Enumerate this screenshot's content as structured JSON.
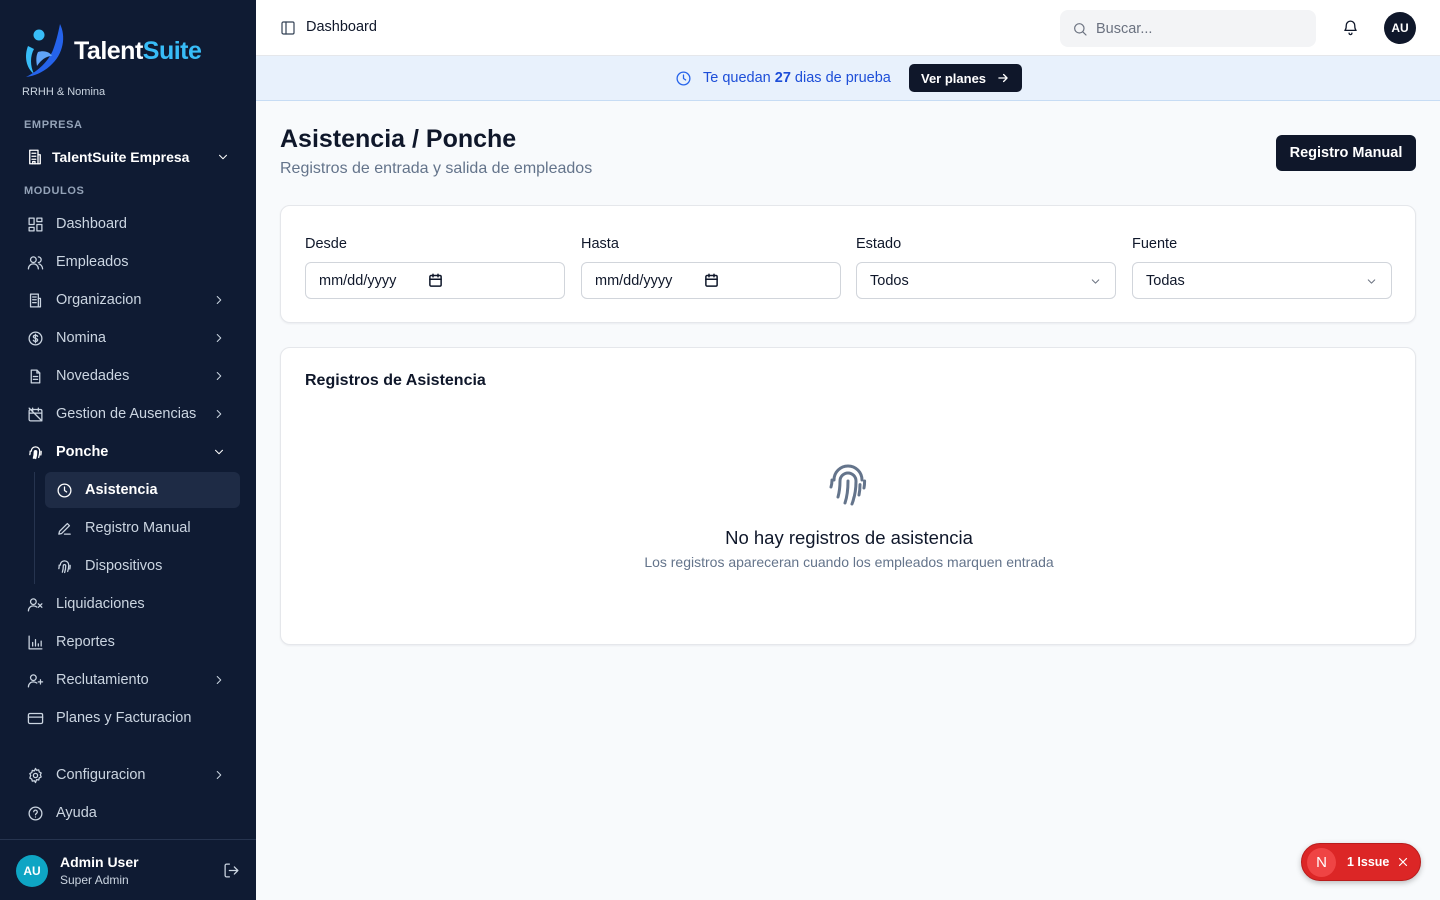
{
  "brand": {
    "name_part1": "Talent",
    "name_part2": "Suite",
    "subtitle": "RRHH & Nomina"
  },
  "sidebar": {
    "company_section": "EMPRESA",
    "company_name": "TalentSuite Empresa",
    "modules_section": "MODULOS",
    "items": [
      {
        "label": "Dashboard",
        "icon": "grid-icon"
      },
      {
        "label": "Empleados",
        "icon": "users-icon"
      },
      {
        "label": "Organizacion",
        "icon": "building-icon"
      },
      {
        "label": "Nomina",
        "icon": "dollar-circle-icon"
      },
      {
        "label": "Novedades",
        "icon": "document-icon"
      },
      {
        "label": "Gestion de Ausencias",
        "icon": "calendar-off-icon"
      },
      {
        "label": "Ponche",
        "icon": "fingerprint-icon"
      },
      {
        "label": "Liquidaciones",
        "icon": "user-x-icon"
      },
      {
        "label": "Reportes",
        "icon": "bar-chart-icon"
      },
      {
        "label": "Reclutamiento",
        "icon": "user-plus-icon"
      },
      {
        "label": "Planes y Facturacion",
        "icon": "credit-card-icon"
      }
    ],
    "sub_items": [
      {
        "label": "Asistencia",
        "icon": "clock-icon"
      },
      {
        "label": "Registro Manual",
        "icon": "pencil-icon"
      },
      {
        "label": "Dispositivos",
        "icon": "fingerprint-icon"
      }
    ],
    "bottom_items": [
      {
        "label": "Configuracion",
        "icon": "gear-icon"
      },
      {
        "label": "Ayuda",
        "icon": "help-circle-icon"
      }
    ],
    "user": {
      "initials": "AU",
      "name": "Admin User",
      "role": "Super Admin"
    }
  },
  "header": {
    "breadcrumb": "Dashboard",
    "search_placeholder": "Buscar...",
    "avatar_initials": "AU"
  },
  "banner": {
    "text_before": "Te quedan ",
    "days": "27",
    "text_after": " dias de prueba",
    "button_label": "Ver planes"
  },
  "page": {
    "title": "Asistencia / Ponche",
    "subtitle": "Registros de entrada y salida de empleados",
    "manual_button": "Registro Manual"
  },
  "filters": {
    "from_label": "Desde",
    "from_value": "mm/dd/yyyy",
    "to_label": "Hasta",
    "to_value": "mm/dd/yyyy",
    "status_label": "Estado",
    "status_value": "Todos",
    "source_label": "Fuente",
    "source_value": "Todas"
  },
  "records": {
    "title": "Registros de Asistencia",
    "empty_title": "No hay registros de asistencia",
    "empty_subtitle": "Los registros apareceran cuando los empleados marquen entrada"
  },
  "issue_badge": {
    "letter": "N",
    "label": "1 Issue"
  },
  "colors": {
    "sidebar_bg": "#0f1b33",
    "primary": "#0f172a",
    "banner_bg": "#e8f1fc",
    "banner_text": "#1d4ed8",
    "issue_red": "#dc2626"
  }
}
